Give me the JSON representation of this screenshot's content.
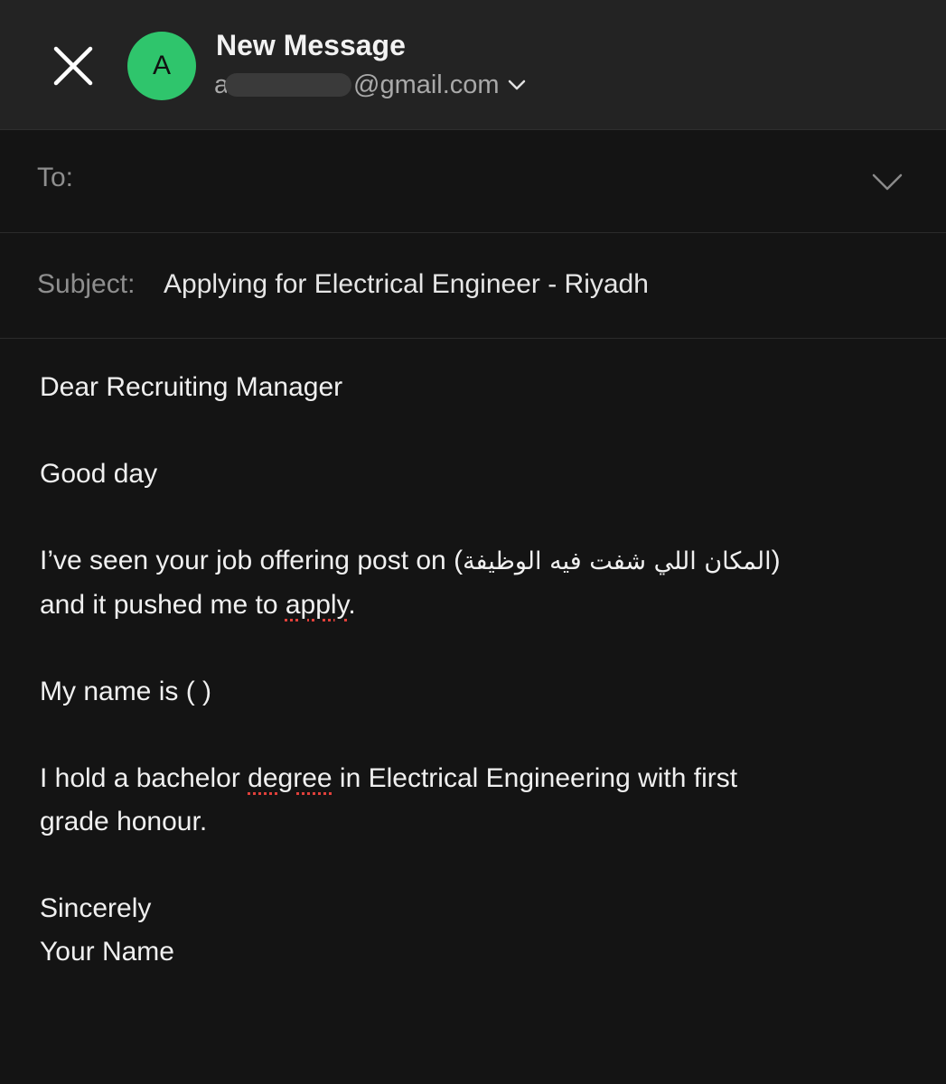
{
  "header": {
    "title": "New Message",
    "avatar_letter": "A",
    "avatar_color": "#2fc56c",
    "account_lead": "a",
    "account_domain": "@gmail.com"
  },
  "to": {
    "label": "To:",
    "value": ""
  },
  "subject": {
    "label": "Subject:",
    "value": "Applying for Electrical Engineer - Riyadh"
  },
  "body": {
    "greeting": "Dear Recruiting Manager",
    "line2": "Good day",
    "p3_pre": "I’ve seen your job offering post on (",
    "p3_arabic": "المكان اللي شفت فيه الوظيفة",
    "p3_post": ")",
    "p3_line2_pre": "and it pushed me to ",
    "p3_line2_word": "apply",
    "p3_line2_post": ".",
    "p4": "My name is ( )",
    "p5_pre": "I hold a bachelor ",
    "p5_word": "degree",
    "p5_post": " in Electrical Engineering with first",
    "p5_line2": "grade honour.",
    "closing": "Sincerely",
    "signature": "Your Name"
  },
  "icons": {
    "close": "close-icon",
    "account_dropdown": "chevron-down-icon",
    "to_expand": "chevron-down-icon"
  }
}
